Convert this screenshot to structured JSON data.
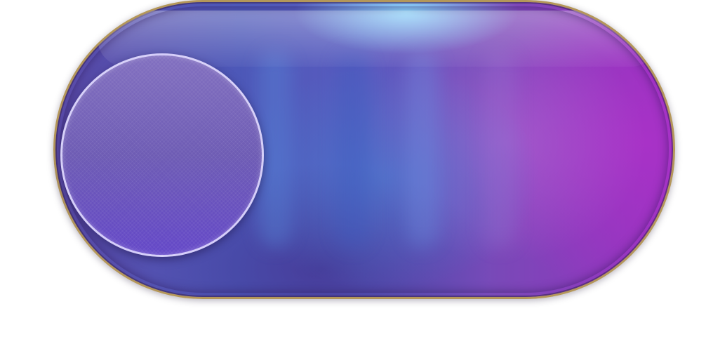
{
  "toggle": {
    "state": "off",
    "knob_position": "left",
    "colors": {
      "track_left": "#5a4aa8",
      "track_mid": "#5a5cc0",
      "track_right": "#9a30c0",
      "glow": "#8cdcff",
      "border": "#b4975a",
      "knob": "#7464bc",
      "knob_ring": "#e1dcff"
    }
  }
}
